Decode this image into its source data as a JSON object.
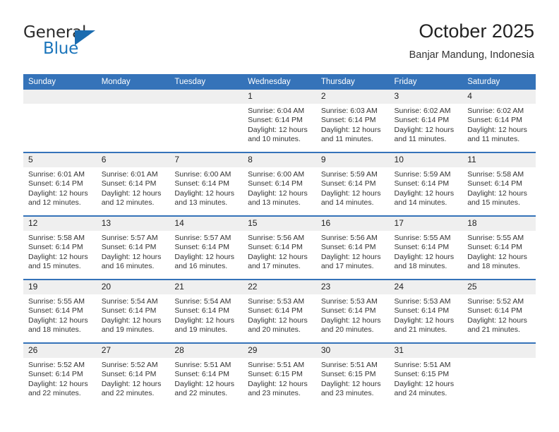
{
  "brand": {
    "name_top": "General",
    "name_bottom": "Blue",
    "accent_color": "#1b75bb",
    "triangle_icon": "triangle-icon"
  },
  "header": {
    "title": "October 2025",
    "subtitle": "Banjar Mandung, Indonesia"
  },
  "calendar": {
    "header_bg": "#3573b9",
    "daynum_bg": "#efefef",
    "weekday_headers": [
      "Sunday",
      "Monday",
      "Tuesday",
      "Wednesday",
      "Thursday",
      "Friday",
      "Saturday"
    ],
    "weeks": [
      [
        {
          "day": "",
          "lines": []
        },
        {
          "day": "",
          "lines": []
        },
        {
          "day": "",
          "lines": []
        },
        {
          "day": "1",
          "lines": [
            "Sunrise: 6:04 AM",
            "Sunset: 6:14 PM",
            "Daylight: 12 hours",
            "and 10 minutes."
          ]
        },
        {
          "day": "2",
          "lines": [
            "Sunrise: 6:03 AM",
            "Sunset: 6:14 PM",
            "Daylight: 12 hours",
            "and 11 minutes."
          ]
        },
        {
          "day": "3",
          "lines": [
            "Sunrise: 6:02 AM",
            "Sunset: 6:14 PM",
            "Daylight: 12 hours",
            "and 11 minutes."
          ]
        },
        {
          "day": "4",
          "lines": [
            "Sunrise: 6:02 AM",
            "Sunset: 6:14 PM",
            "Daylight: 12 hours",
            "and 11 minutes."
          ]
        }
      ],
      [
        {
          "day": "5",
          "lines": [
            "Sunrise: 6:01 AM",
            "Sunset: 6:14 PM",
            "Daylight: 12 hours",
            "and 12 minutes."
          ]
        },
        {
          "day": "6",
          "lines": [
            "Sunrise: 6:01 AM",
            "Sunset: 6:14 PM",
            "Daylight: 12 hours",
            "and 12 minutes."
          ]
        },
        {
          "day": "7",
          "lines": [
            "Sunrise: 6:00 AM",
            "Sunset: 6:14 PM",
            "Daylight: 12 hours",
            "and 13 minutes."
          ]
        },
        {
          "day": "8",
          "lines": [
            "Sunrise: 6:00 AM",
            "Sunset: 6:14 PM",
            "Daylight: 12 hours",
            "and 13 minutes."
          ]
        },
        {
          "day": "9",
          "lines": [
            "Sunrise: 5:59 AM",
            "Sunset: 6:14 PM",
            "Daylight: 12 hours",
            "and 14 minutes."
          ]
        },
        {
          "day": "10",
          "lines": [
            "Sunrise: 5:59 AM",
            "Sunset: 6:14 PM",
            "Daylight: 12 hours",
            "and 14 minutes."
          ]
        },
        {
          "day": "11",
          "lines": [
            "Sunrise: 5:58 AM",
            "Sunset: 6:14 PM",
            "Daylight: 12 hours",
            "and 15 minutes."
          ]
        }
      ],
      [
        {
          "day": "12",
          "lines": [
            "Sunrise: 5:58 AM",
            "Sunset: 6:14 PM",
            "Daylight: 12 hours",
            "and 15 minutes."
          ]
        },
        {
          "day": "13",
          "lines": [
            "Sunrise: 5:57 AM",
            "Sunset: 6:14 PM",
            "Daylight: 12 hours",
            "and 16 minutes."
          ]
        },
        {
          "day": "14",
          "lines": [
            "Sunrise: 5:57 AM",
            "Sunset: 6:14 PM",
            "Daylight: 12 hours",
            "and 16 minutes."
          ]
        },
        {
          "day": "15",
          "lines": [
            "Sunrise: 5:56 AM",
            "Sunset: 6:14 PM",
            "Daylight: 12 hours",
            "and 17 minutes."
          ]
        },
        {
          "day": "16",
          "lines": [
            "Sunrise: 5:56 AM",
            "Sunset: 6:14 PM",
            "Daylight: 12 hours",
            "and 17 minutes."
          ]
        },
        {
          "day": "17",
          "lines": [
            "Sunrise: 5:55 AM",
            "Sunset: 6:14 PM",
            "Daylight: 12 hours",
            "and 18 minutes."
          ]
        },
        {
          "day": "18",
          "lines": [
            "Sunrise: 5:55 AM",
            "Sunset: 6:14 PM",
            "Daylight: 12 hours",
            "and 18 minutes."
          ]
        }
      ],
      [
        {
          "day": "19",
          "lines": [
            "Sunrise: 5:55 AM",
            "Sunset: 6:14 PM",
            "Daylight: 12 hours",
            "and 18 minutes."
          ]
        },
        {
          "day": "20",
          "lines": [
            "Sunrise: 5:54 AM",
            "Sunset: 6:14 PM",
            "Daylight: 12 hours",
            "and 19 minutes."
          ]
        },
        {
          "day": "21",
          "lines": [
            "Sunrise: 5:54 AM",
            "Sunset: 6:14 PM",
            "Daylight: 12 hours",
            "and 19 minutes."
          ]
        },
        {
          "day": "22",
          "lines": [
            "Sunrise: 5:53 AM",
            "Sunset: 6:14 PM",
            "Daylight: 12 hours",
            "and 20 minutes."
          ]
        },
        {
          "day": "23",
          "lines": [
            "Sunrise: 5:53 AM",
            "Sunset: 6:14 PM",
            "Daylight: 12 hours",
            "and 20 minutes."
          ]
        },
        {
          "day": "24",
          "lines": [
            "Sunrise: 5:53 AM",
            "Sunset: 6:14 PM",
            "Daylight: 12 hours",
            "and 21 minutes."
          ]
        },
        {
          "day": "25",
          "lines": [
            "Sunrise: 5:52 AM",
            "Sunset: 6:14 PM",
            "Daylight: 12 hours",
            "and 21 minutes."
          ]
        }
      ],
      [
        {
          "day": "26",
          "lines": [
            "Sunrise: 5:52 AM",
            "Sunset: 6:14 PM",
            "Daylight: 12 hours",
            "and 22 minutes."
          ]
        },
        {
          "day": "27",
          "lines": [
            "Sunrise: 5:52 AM",
            "Sunset: 6:14 PM",
            "Daylight: 12 hours",
            "and 22 minutes."
          ]
        },
        {
          "day": "28",
          "lines": [
            "Sunrise: 5:51 AM",
            "Sunset: 6:14 PM",
            "Daylight: 12 hours",
            "and 22 minutes."
          ]
        },
        {
          "day": "29",
          "lines": [
            "Sunrise: 5:51 AM",
            "Sunset: 6:15 PM",
            "Daylight: 12 hours",
            "and 23 minutes."
          ]
        },
        {
          "day": "30",
          "lines": [
            "Sunrise: 5:51 AM",
            "Sunset: 6:15 PM",
            "Daylight: 12 hours",
            "and 23 minutes."
          ]
        },
        {
          "day": "31",
          "lines": [
            "Sunrise: 5:51 AM",
            "Sunset: 6:15 PM",
            "Daylight: 12 hours",
            "and 24 minutes."
          ]
        },
        {
          "day": "",
          "lines": []
        }
      ]
    ]
  }
}
